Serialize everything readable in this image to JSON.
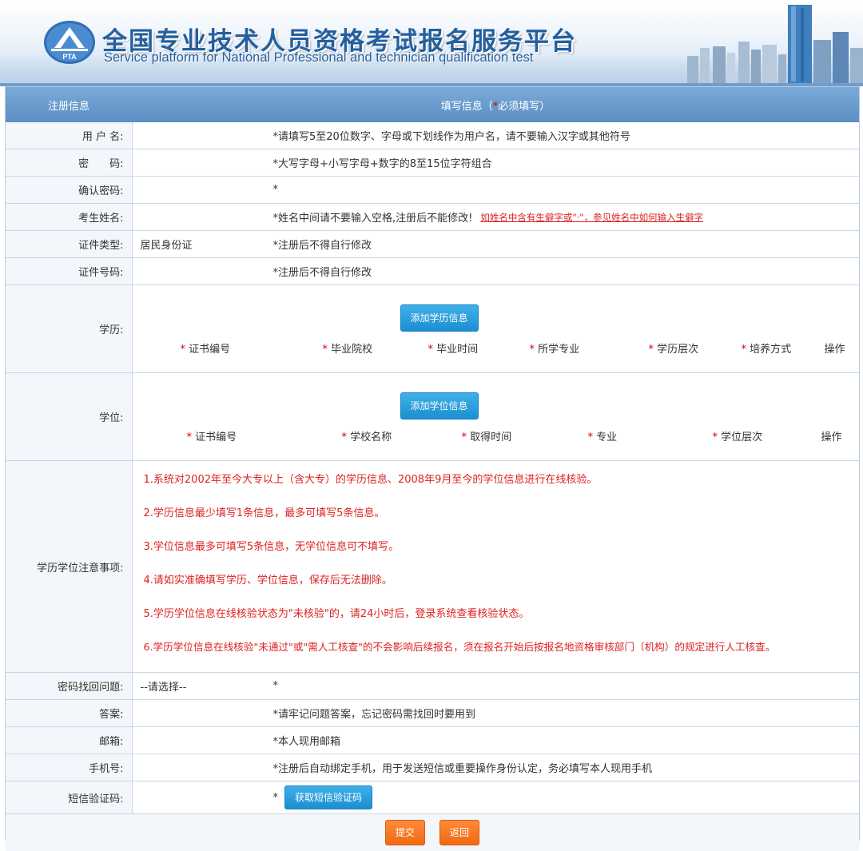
{
  "header": {
    "title_cn": "全国专业技术人员资格考试报名服务平台",
    "title_en": "Service platform for National Professional and technician  qualification test",
    "logo_text": "PTA"
  },
  "table_head": {
    "left": "注册信息",
    "right_prefix": "填写信息（",
    "right_star": "*",
    "right_suffix": "必须填写）"
  },
  "fields": {
    "username": {
      "label": "用 户 名:",
      "value": "",
      "hint": "*请填写5至20位数字、字母或下划线作为用户名，请不要输入汉字或其他符号"
    },
    "password": {
      "label": "密　　码:",
      "value": "",
      "hint": "*大写字母+小写字母+数字的8至15位字符组合"
    },
    "confirm": {
      "label": "确认密码:",
      "value": "",
      "hint": "*"
    },
    "name": {
      "label": "考生姓名:",
      "value": "",
      "hint": "*姓名中间请不要输入空格,注册后不能修改!",
      "link": "如姓名中含有生僻字或\"·\"，参见姓名中如何输入生僻字"
    },
    "id_type": {
      "label": "证件类型:",
      "value": "居民身份证",
      "hint": "*注册后不得自行修改"
    },
    "id_number": {
      "label": "证件号码:",
      "value": "",
      "hint": "*注册后不得自行修改"
    },
    "question": {
      "label": "密码找回问题:",
      "value": "--请选择--",
      "hint": "*"
    },
    "answer": {
      "label": "答案:",
      "value": "",
      "hint": "*请牢记问题答案，忘记密码需找回时要用到"
    },
    "email": {
      "label": "邮箱:",
      "value": "",
      "hint": "*本人现用邮箱"
    },
    "phone": {
      "label": "手机号:",
      "value": "",
      "hint": "*注册后自动绑定手机，用于发送短信或重要操作身份认定，务必填写本人现用手机"
    },
    "sms": {
      "label": "短信验证码:",
      "value": "",
      "hint": "*",
      "button": "获取短信验证码"
    }
  },
  "education": {
    "label": "学历:",
    "add_button": "添加学历信息",
    "columns": [
      "证书编号",
      "毕业院校",
      "毕业时间",
      "所学专业",
      "学历层次",
      "培养方式"
    ],
    "action": "操作"
  },
  "degree": {
    "label": "学位:",
    "add_button": "添加学位信息",
    "columns": [
      "证书编号",
      "学校名称",
      "取得时间",
      "专业",
      "学位层次"
    ],
    "action": "操作"
  },
  "notes": {
    "label": "学历学位注意事项:",
    "items": [
      "1.系统对2002年至今大专以上（含大专）的学历信息、2008年9月至今的学位信息进行在线核验。",
      "2.学历信息最少填写1条信息，最多可填写5条信息。",
      "3.学位信息最多可填写5条信息，无学位信息可不填写。",
      "4.请如实准确填写学历、学位信息，保存后无法删除。",
      "5.学历学位信息在线核验状态为\"未核验\"的，请24小时后，登录系统查看核验状态。",
      "6.学历学位信息在线核验\"未通过\"或\"需人工核查\"的不会影响后续报名，须在报名开始后按报名地资格审核部门（机构）的规定进行人工核查。"
    ]
  },
  "actions": {
    "submit": "提交",
    "back": "返回"
  },
  "colors": {
    "header_blue": "#5c8fc4",
    "button_blue": "#1b8fd0",
    "button_orange": "#f06a12",
    "note_red": "#d22"
  }
}
